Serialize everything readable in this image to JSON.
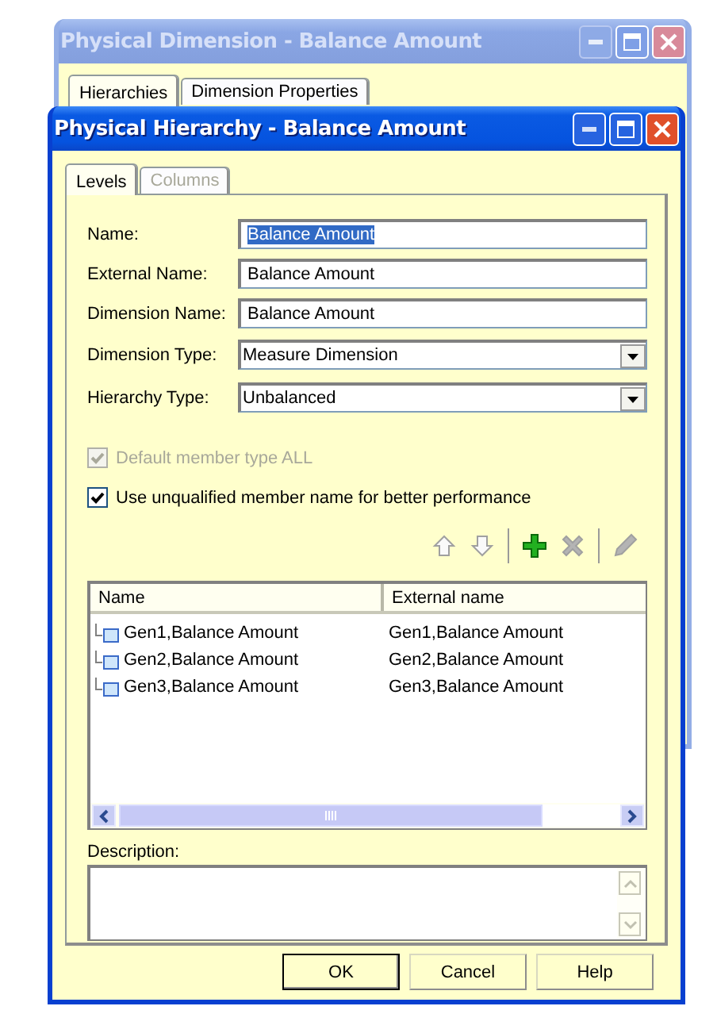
{
  "background_window": {
    "title": "Physical Dimension - Balance Amount",
    "active": false,
    "tabs": [
      {
        "label": "Hierarchies",
        "selected": true,
        "disabled": false
      },
      {
        "label": "Dimension Properties",
        "selected": false,
        "disabled": false
      }
    ]
  },
  "window": {
    "title": "Physical Hierarchy - Balance Amount",
    "active": true,
    "tabs": [
      {
        "label": "Levels",
        "selected": true,
        "disabled": false
      },
      {
        "label": "Columns",
        "selected": false,
        "disabled": true
      }
    ],
    "fields": [
      {
        "label": "Name:",
        "kind": "text",
        "value": "Balance Amount",
        "text_selected": true
      },
      {
        "label": "External Name:",
        "kind": "text",
        "value": "Balance Amount",
        "text_selected": false
      },
      {
        "label": "Dimension Name:",
        "kind": "text",
        "value": "Balance Amount",
        "text_selected": false
      },
      {
        "label": "Dimension Type:",
        "kind": "select",
        "value": "Measure Dimension",
        "text_selected": false
      },
      {
        "label": "Hierarchy Type:",
        "kind": "select",
        "value": "Unbalanced",
        "text_selected": false
      }
    ],
    "checkboxes": [
      {
        "label": "Default member type ALL",
        "checked": true,
        "disabled": true
      },
      {
        "label": "Use unqualified member name for better performance",
        "checked": true,
        "disabled": false
      }
    ],
    "toolbar": [
      {
        "kind": "up",
        "disabled": true
      },
      {
        "kind": "down",
        "disabled": true
      },
      {
        "kind": "add",
        "disabled": false
      },
      {
        "kind": "delete",
        "disabled": true
      },
      {
        "kind": "edit",
        "disabled": true
      }
    ],
    "table": {
      "columns": [
        "Name",
        "External name"
      ],
      "rows": [
        [
          "Gen1,Balance Amount",
          "Gen1,Balance Amount"
        ],
        [
          "Gen2,Balance Amount",
          "Gen2,Balance Amount"
        ],
        [
          "Gen3,Balance Amount",
          "Gen3,Balance Amount"
        ]
      ]
    },
    "description": {
      "label": "Description:"
    },
    "buttons": [
      {
        "label": "OK",
        "default": true
      },
      {
        "label": "Cancel",
        "default": false
      },
      {
        "label": "Help",
        "default": false
      }
    ]
  }
}
